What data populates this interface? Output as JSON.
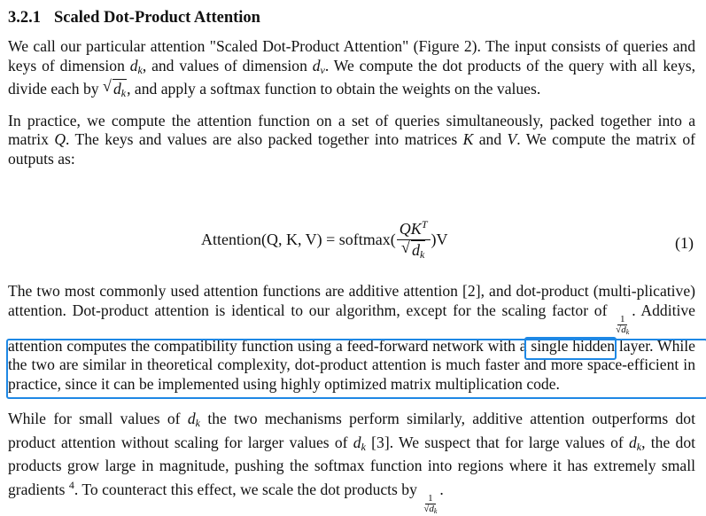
{
  "section": {
    "number": "3.2.1",
    "title": "Scaled Dot-Product Attention"
  },
  "paragraphs": {
    "p1_a": "We call our particular attention \"Scaled Dot-Product Attention\" (Figure 2). The input consists of queries and keys of dimension ",
    "p1_b": ", and values of dimension ",
    "p1_c": ". We compute the dot products of the query with all keys, divide each by ",
    "p1_d": ", and apply a softmax function to obtain the weights on the values.",
    "p2_a": "In practice, we compute the attention function on a set of queries simultaneously, packed together into a matrix ",
    "p2_b": ". The keys and values are also packed together into matrices ",
    "p2_c": " and ",
    "p2_d": ". We compute the matrix of outputs as:",
    "p3_a": "The two most commonly used attention functions are additive attention [2], and dot-product (multi-plicative) attention. Dot-product attention is identical to our algorithm, except for the scaling factor of ",
    "p3_b": ". Additive attention computes the compatibility function using a feed-forward network with a single hidden layer. While the two are similar in theoretical complexity, ",
    "p3_highlight": "dot-product",
    "p3_c": " attention is much faster and more space-efficient in practice, since it can be implemented using highly optimized matrix multiplication code.",
    "p4_a": "While for small values of ",
    "p4_b": " the two mechanisms perform similarly, additive attention outperforms dot product attention without scaling for larger values of ",
    "p4_c": " [3]. We suspect that for large values of ",
    "p4_d": ", the dot products grow large in magnitude, pushing the softmax function into regions where it has extremely small gradients ",
    "p4_footnote": "4",
    "p4_e": ". To counteract this effect, we scale the dot products by "
  },
  "math": {
    "d": "d",
    "k": "k",
    "v": "v",
    "Q": "Q",
    "K": "K",
    "V": "V",
    "one": "1",
    "radical": "√"
  },
  "equation": {
    "lhs": "Attention(Q, K, V) = softmax(",
    "numerator": "QK",
    "numerator_sup": "T",
    "rhs": ")V",
    "number": "(1)"
  },
  "highlight_color": "#1e88e5"
}
